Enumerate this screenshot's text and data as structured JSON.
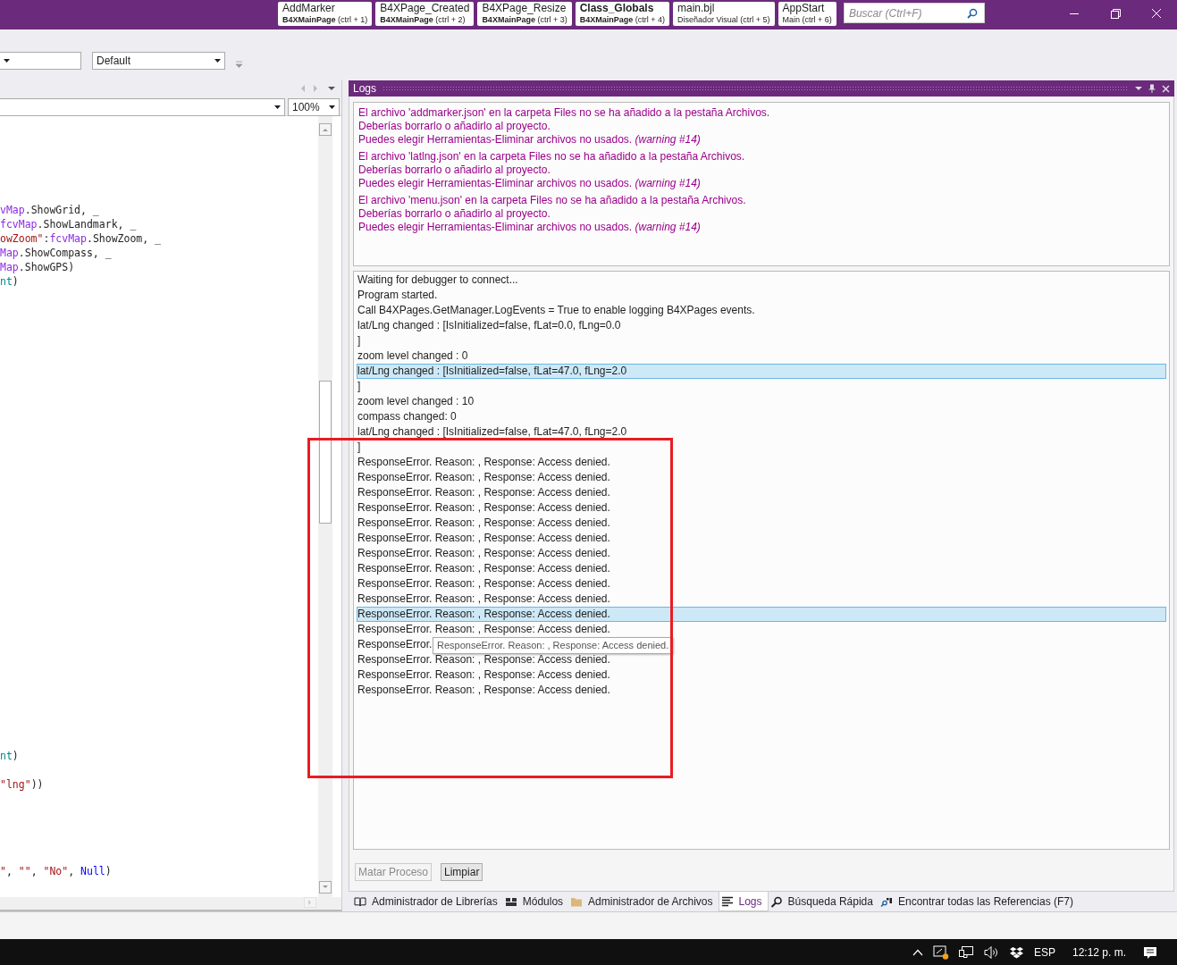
{
  "doc_tabs": [
    {
      "title": "AddMarker",
      "subtitle": "**B4XMainPage**  (ctrl + 1)",
      "selected": false
    },
    {
      "title": "B4XPage_Created",
      "subtitle": "**B4XMainPage**  (ctrl + 2)",
      "selected": false
    },
    {
      "title": "B4XPage_Resize",
      "subtitle": "**B4XMainPage**  (ctrl + 3)",
      "selected": false
    },
    {
      "title": "Class_Globals",
      "subtitle": "**B4XMainPage**  (ctrl + 4)",
      "selected": true
    },
    {
      "title": "main.bjl",
      "subtitle": "Diseñador Visual  (ctrl + 5)",
      "selected": false
    },
    {
      "title": "AppStart",
      "subtitle": "Main  (ctrl + 6)",
      "selected": false
    }
  ],
  "search": {
    "placeholder": "Buscar (Ctrl+F)"
  },
  "toolbar": {
    "build_combo": {
      "value": "Default"
    }
  },
  "editor": {
    "zoom": "100%",
    "lines": [
      {
        "kind": "blank"
      },
      {
        "kind": "blank"
      },
      {
        "kind": "blank"
      },
      {
        "kind": "blank"
      },
      {
        "kind": "blank"
      },
      {
        "kind": "blank"
      },
      {
        "kind": "code",
        "tokens": [
          {
            "kind": "ident",
            "text": "vMap"
          },
          {
            "kind": "plain",
            "text": ".ShowGrid, _"
          }
        ]
      },
      {
        "kind": "code",
        "tokens": [
          {
            "kind": "ident",
            "text": "fcvMap"
          },
          {
            "kind": "plain",
            "text": ".ShowLandmark, _"
          }
        ]
      },
      {
        "kind": "code",
        "tokens": [
          {
            "kind": "string",
            "text": "owZoom\""
          },
          {
            "kind": "plain",
            "text": ":"
          },
          {
            "kind": "ident",
            "text": "fcvMap"
          },
          {
            "kind": "plain",
            "text": ".ShowZoom, _"
          }
        ]
      },
      {
        "kind": "code",
        "tokens": [
          {
            "kind": "ident",
            "text": "Map"
          },
          {
            "kind": "plain",
            "text": ".ShowCompass, _"
          }
        ]
      },
      {
        "kind": "code",
        "tokens": [
          {
            "kind": "ident",
            "text": "Map"
          },
          {
            "kind": "plain",
            "text": ".ShowGPS)"
          }
        ]
      },
      {
        "kind": "code",
        "tokens": [
          {
            "kind": "type",
            "text": "nt"
          },
          {
            "kind": "plain",
            "text": ")"
          }
        ]
      },
      {
        "kind": "blank"
      },
      {
        "kind": "blank"
      },
      {
        "kind": "blank"
      },
      {
        "kind": "blank"
      },
      {
        "kind": "blank"
      },
      {
        "kind": "blank"
      },
      {
        "kind": "blank"
      },
      {
        "kind": "blank"
      },
      {
        "kind": "blank"
      },
      {
        "kind": "blank"
      },
      {
        "kind": "blank"
      },
      {
        "kind": "blank"
      },
      {
        "kind": "blank"
      },
      {
        "kind": "blank"
      },
      {
        "kind": "blank"
      },
      {
        "kind": "blank"
      },
      {
        "kind": "blank"
      },
      {
        "kind": "blank"
      },
      {
        "kind": "blank"
      },
      {
        "kind": "blank"
      },
      {
        "kind": "blank"
      },
      {
        "kind": "blank"
      },
      {
        "kind": "blank"
      },
      {
        "kind": "blank"
      },
      {
        "kind": "blank"
      },
      {
        "kind": "blank"
      },
      {
        "kind": "blank"
      },
      {
        "kind": "blank"
      },
      {
        "kind": "blank"
      },
      {
        "kind": "blank"
      },
      {
        "kind": "blank"
      },
      {
        "kind": "blank"
      },
      {
        "kind": "code",
        "tokens": [
          {
            "kind": "type",
            "text": "nt"
          },
          {
            "kind": "plain",
            "text": ")"
          }
        ]
      },
      {
        "kind": "blank"
      },
      {
        "kind": "code",
        "tokens": [
          {
            "kind": "string",
            "text": "\"lng\""
          },
          {
            "kind": "plain",
            "text": "))"
          }
        ]
      },
      {
        "kind": "blank"
      },
      {
        "kind": "blank"
      },
      {
        "kind": "blank"
      },
      {
        "kind": "blank"
      },
      {
        "kind": "blank"
      },
      {
        "kind": "code",
        "tokens": [
          {
            "kind": "string",
            "text": "\""
          },
          {
            "kind": "plain",
            "text": ", "
          },
          {
            "kind": "string",
            "text": "\"\""
          },
          {
            "kind": "plain",
            "text": ", "
          },
          {
            "kind": "string",
            "text": "\"No\""
          },
          {
            "kind": "plain",
            "text": ", "
          },
          {
            "kind": "keyword",
            "text": "Null"
          },
          {
            "kind": "plain",
            "text": ")"
          }
        ]
      }
    ]
  },
  "logs": {
    "title": "Logs",
    "warnings": [
      [
        "El archivo 'addmarker.json' en la carpeta Files no se ha añadido a la pestaña Archivos.",
        "Deberías borrarlo o añadirlo al proyecto.",
        "Puedes elegir Herramientas-Eliminar archivos no usados. *(warning #14)*"
      ],
      [
        "El archivo 'latlng.json' en la carpeta Files no se ha añadido a la pestaña Archivos.",
        "Deberías borrarlo o añadirlo al proyecto.",
        "Puedes elegir Herramientas-Eliminar archivos no usados. *(warning #14)*"
      ],
      [
        "El archivo 'menu.json' en la carpeta Files no se ha añadido a la pestaña Archivos.",
        "Deberías borrarlo o añadirlo al proyecto.",
        "Puedes elegir Herramientas-Eliminar archivos no usados. *(warning #14)*"
      ]
    ],
    "lines": [
      {
        "text": "Waiting for debugger to connect...",
        "selected": false
      },
      {
        "text": "Program started.",
        "selected": false
      },
      {
        "text": "Call B4XPages.GetManager.LogEvents = True to enable logging B4XPages events.",
        "selected": false
      },
      {
        "text": "lat/Lng changed : [IsInitialized=false, fLat=0.0, fLng=0.0",
        "selected": false
      },
      {
        "text": "]",
        "selected": false
      },
      {
        "text": "zoom level changed : 0",
        "selected": false
      },
      {
        "text": "lat/Lng changed : [IsInitialized=false, fLat=47.0, fLng=2.0",
        "selected": true
      },
      {
        "text": "]",
        "selected": false
      },
      {
        "text": "zoom level changed : 10",
        "selected": false
      },
      {
        "text": "compass changed: 0",
        "selected": false
      },
      {
        "text": "lat/Lng changed : [IsInitialized=false, fLat=47.0, fLng=2.0",
        "selected": false
      },
      {
        "text": "]",
        "selected": false
      },
      {
        "text": "ResponseError. Reason: , Response: Access denied.",
        "selected": false
      },
      {
        "text": "ResponseError. Reason: , Response: Access denied.",
        "selected": false
      },
      {
        "text": "ResponseError. Reason: , Response: Access denied.",
        "selected": false
      },
      {
        "text": "ResponseError. Reason: , Response: Access denied.",
        "selected": false
      },
      {
        "text": "ResponseError. Reason: , Response: Access denied.",
        "selected": false
      },
      {
        "text": "ResponseError. Reason: , Response: Access denied.",
        "selected": false
      },
      {
        "text": "ResponseError. Reason: , Response: Access denied.",
        "selected": false
      },
      {
        "text": "ResponseError. Reason: , Response: Access denied.",
        "selected": false
      },
      {
        "text": "ResponseError. Reason: , Response: Access denied.",
        "selected": false
      },
      {
        "text": "ResponseError. Reason: , Response: Access denied.",
        "selected": false
      },
      {
        "text": "ResponseError. Reason: , Response: Access denied.",
        "selected": true
      },
      {
        "text": "ResponseError. Reason: , Response: Access denied.",
        "selected": false
      },
      {
        "text": "ResponseError.",
        "selected": false,
        "tooltip": "ResponseError. Reason: , Response: Access denied."
      },
      {
        "text": "ResponseError. Reason: , Response: Access denied.",
        "selected": false
      },
      {
        "text": "ResponseError. Reason: , Response: Access denied.",
        "selected": false
      },
      {
        "text": "ResponseError. Reason: , Response: Access denied.",
        "selected": false
      }
    ],
    "buttons": [
      {
        "label": "Matar Proceso",
        "disabled": true
      },
      {
        "label": "Limpiar",
        "disabled": false
      }
    ]
  },
  "bottom_tabs": [
    {
      "label": "Administrador de Librerías",
      "selected": false
    },
    {
      "label": "Módulos",
      "selected": false
    },
    {
      "label": "Administrador de Archivos",
      "selected": false
    },
    {
      "label": "Logs",
      "selected": true
    },
    {
      "label": "Búsqueda Rápida",
      "selected": false
    },
    {
      "label": "Encontrar todas las Referencias (F7)",
      "selected": false
    }
  ],
  "taskbar": {
    "language": "ESP",
    "clock": "12:12 p. m."
  },
  "annotations": [
    {
      "kind": "rectangle"
    }
  ]
}
